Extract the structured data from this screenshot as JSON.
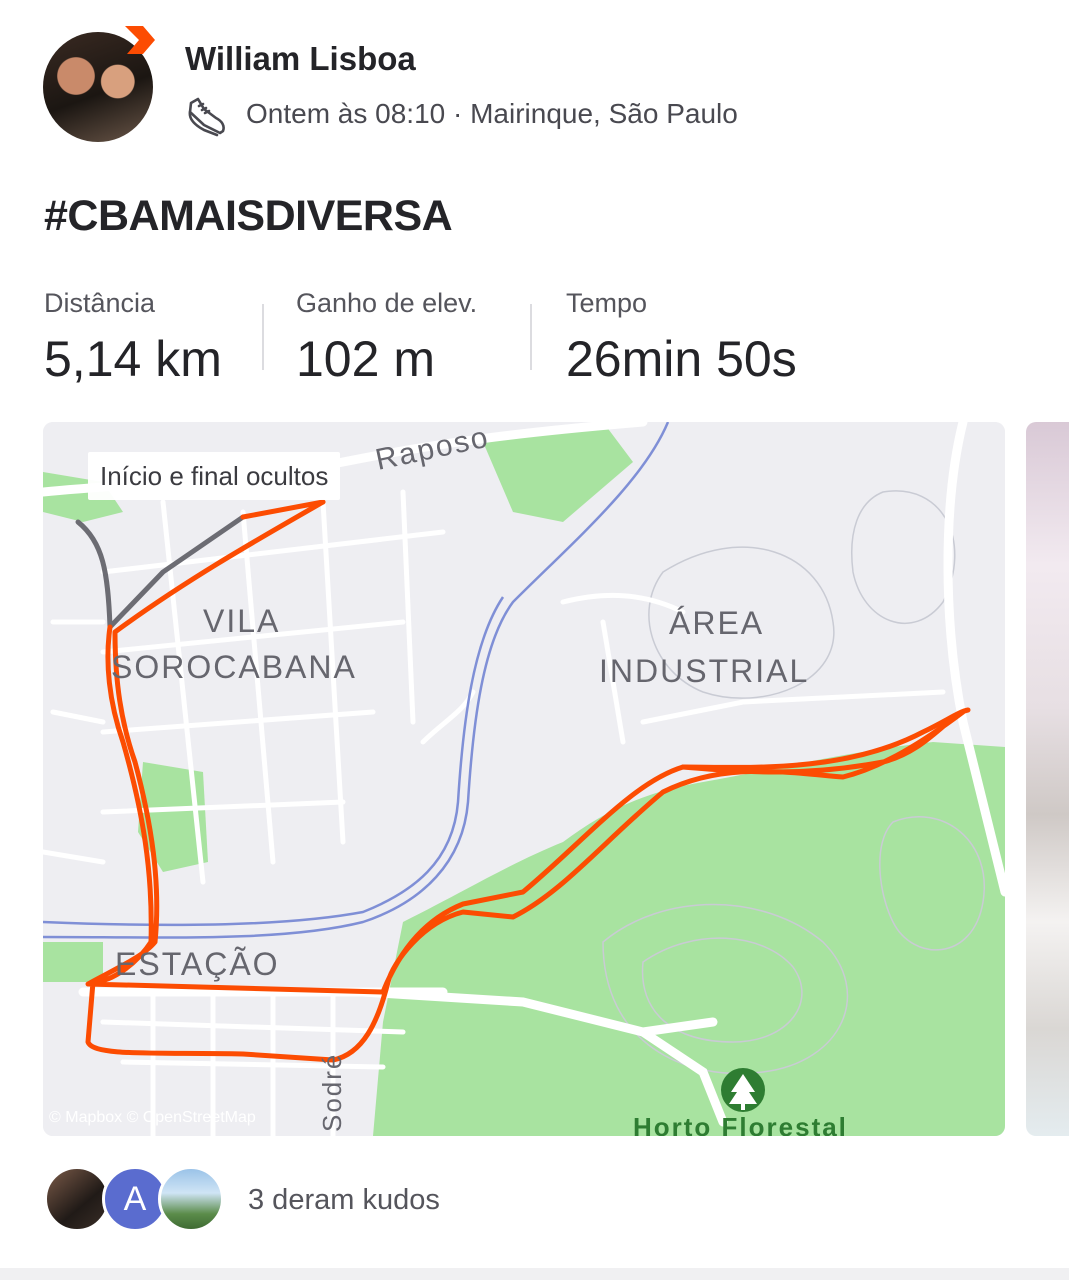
{
  "header": {
    "athlete_name": "William Lisboa",
    "meta": "Ontem às 08:10 · Mairinque, São Paulo",
    "activity_icon": "running-shoe-icon"
  },
  "activity": {
    "title": "#CBAMAISDIVERSA"
  },
  "stats": [
    {
      "label": "Distância",
      "value": "5,14 km"
    },
    {
      "label": "Ganho de elev.",
      "value": "102 m"
    },
    {
      "label": "Tempo",
      "value": "26min 50s"
    }
  ],
  "map": {
    "hidden_badge": "Início e final ocultos",
    "labels": {
      "road": "Raposo",
      "vila_1": "VILA",
      "vila_2": "SOROCABANA",
      "area_1": "ÁREA",
      "area_2": "INDUSTRIAL",
      "estacao": "ESTAÇÃO",
      "sodre": "Sodré",
      "horto": "Horto Florestal",
      "attribution": "© Mapbox © OpenStreetMap"
    },
    "route_color": "#fc4c02",
    "park_icon": "tree-icon"
  },
  "kudos": {
    "avatar_letter": "A",
    "text": "3 deram kudos"
  },
  "colors": {
    "brand": "#fc4c02",
    "park": "#a8e3a0",
    "rail": "#7f8fd6"
  }
}
